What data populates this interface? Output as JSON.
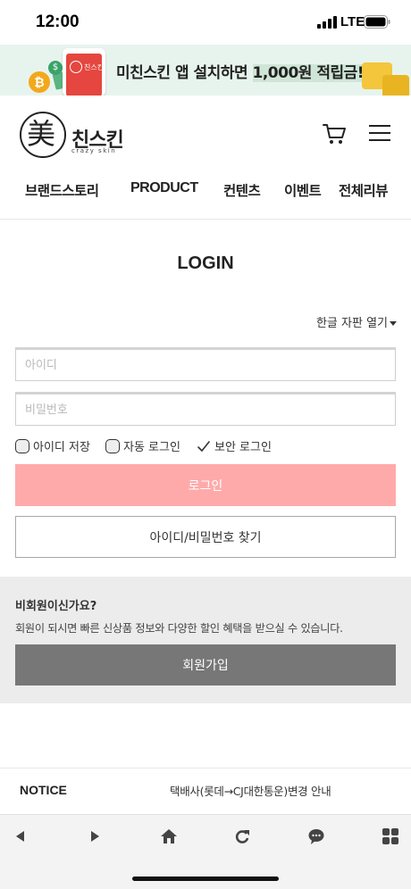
{
  "status_bar": {
    "time": "12:00",
    "network": "LTE"
  },
  "banner": {
    "text_before": "미친스킨 앱 설치하면 ",
    "text_highlight": "1,000원 적립금!",
    "phone_label": "친스킨",
    "coin_symbol": "₿",
    "coin2_symbol": "$"
  },
  "header": {
    "logo_hanja": "美",
    "logo_name": "친스킨",
    "logo_sub": "crazy skin"
  },
  "nav": {
    "items": [
      "브랜드스토리",
      "PRODUCT",
      "컨텐츠",
      "이벤트",
      "전체리뷰"
    ]
  },
  "login": {
    "title": "LOGIN",
    "keyboard_toggle": "한글 자판 열기",
    "id_placeholder": "아이디",
    "pw_placeholder": "비밀번호",
    "save_id": "아이디 저장",
    "auto_login": "자동 로그인",
    "secure_login": "보안 로그인",
    "login_button": "로그인",
    "find_button": "아이디/비밀번호 찾기"
  },
  "nonmember": {
    "question": "비회원이신가요?",
    "description": "회원이 되시면 빠른 신상품 정보와 다양한 할인 혜택을 받으실 수 있습니다.",
    "join_button": "회원가입"
  },
  "notice": {
    "label": "NOTICE",
    "headline": "택배사(롯데→CJ대한통운)변경 안내"
  },
  "colors": {
    "login_button": "#ffaaaa",
    "join_button": "#777777",
    "banner_bg": "#e7f4ee"
  },
  "icons": {
    "cart": "cart-icon",
    "menu": "menu-icon",
    "back": "back-arrow-icon",
    "forward": "forward-arrow-icon",
    "home": "home-icon",
    "refresh": "refresh-icon",
    "chat": "chat-icon",
    "apps": "apps-grid-icon"
  }
}
